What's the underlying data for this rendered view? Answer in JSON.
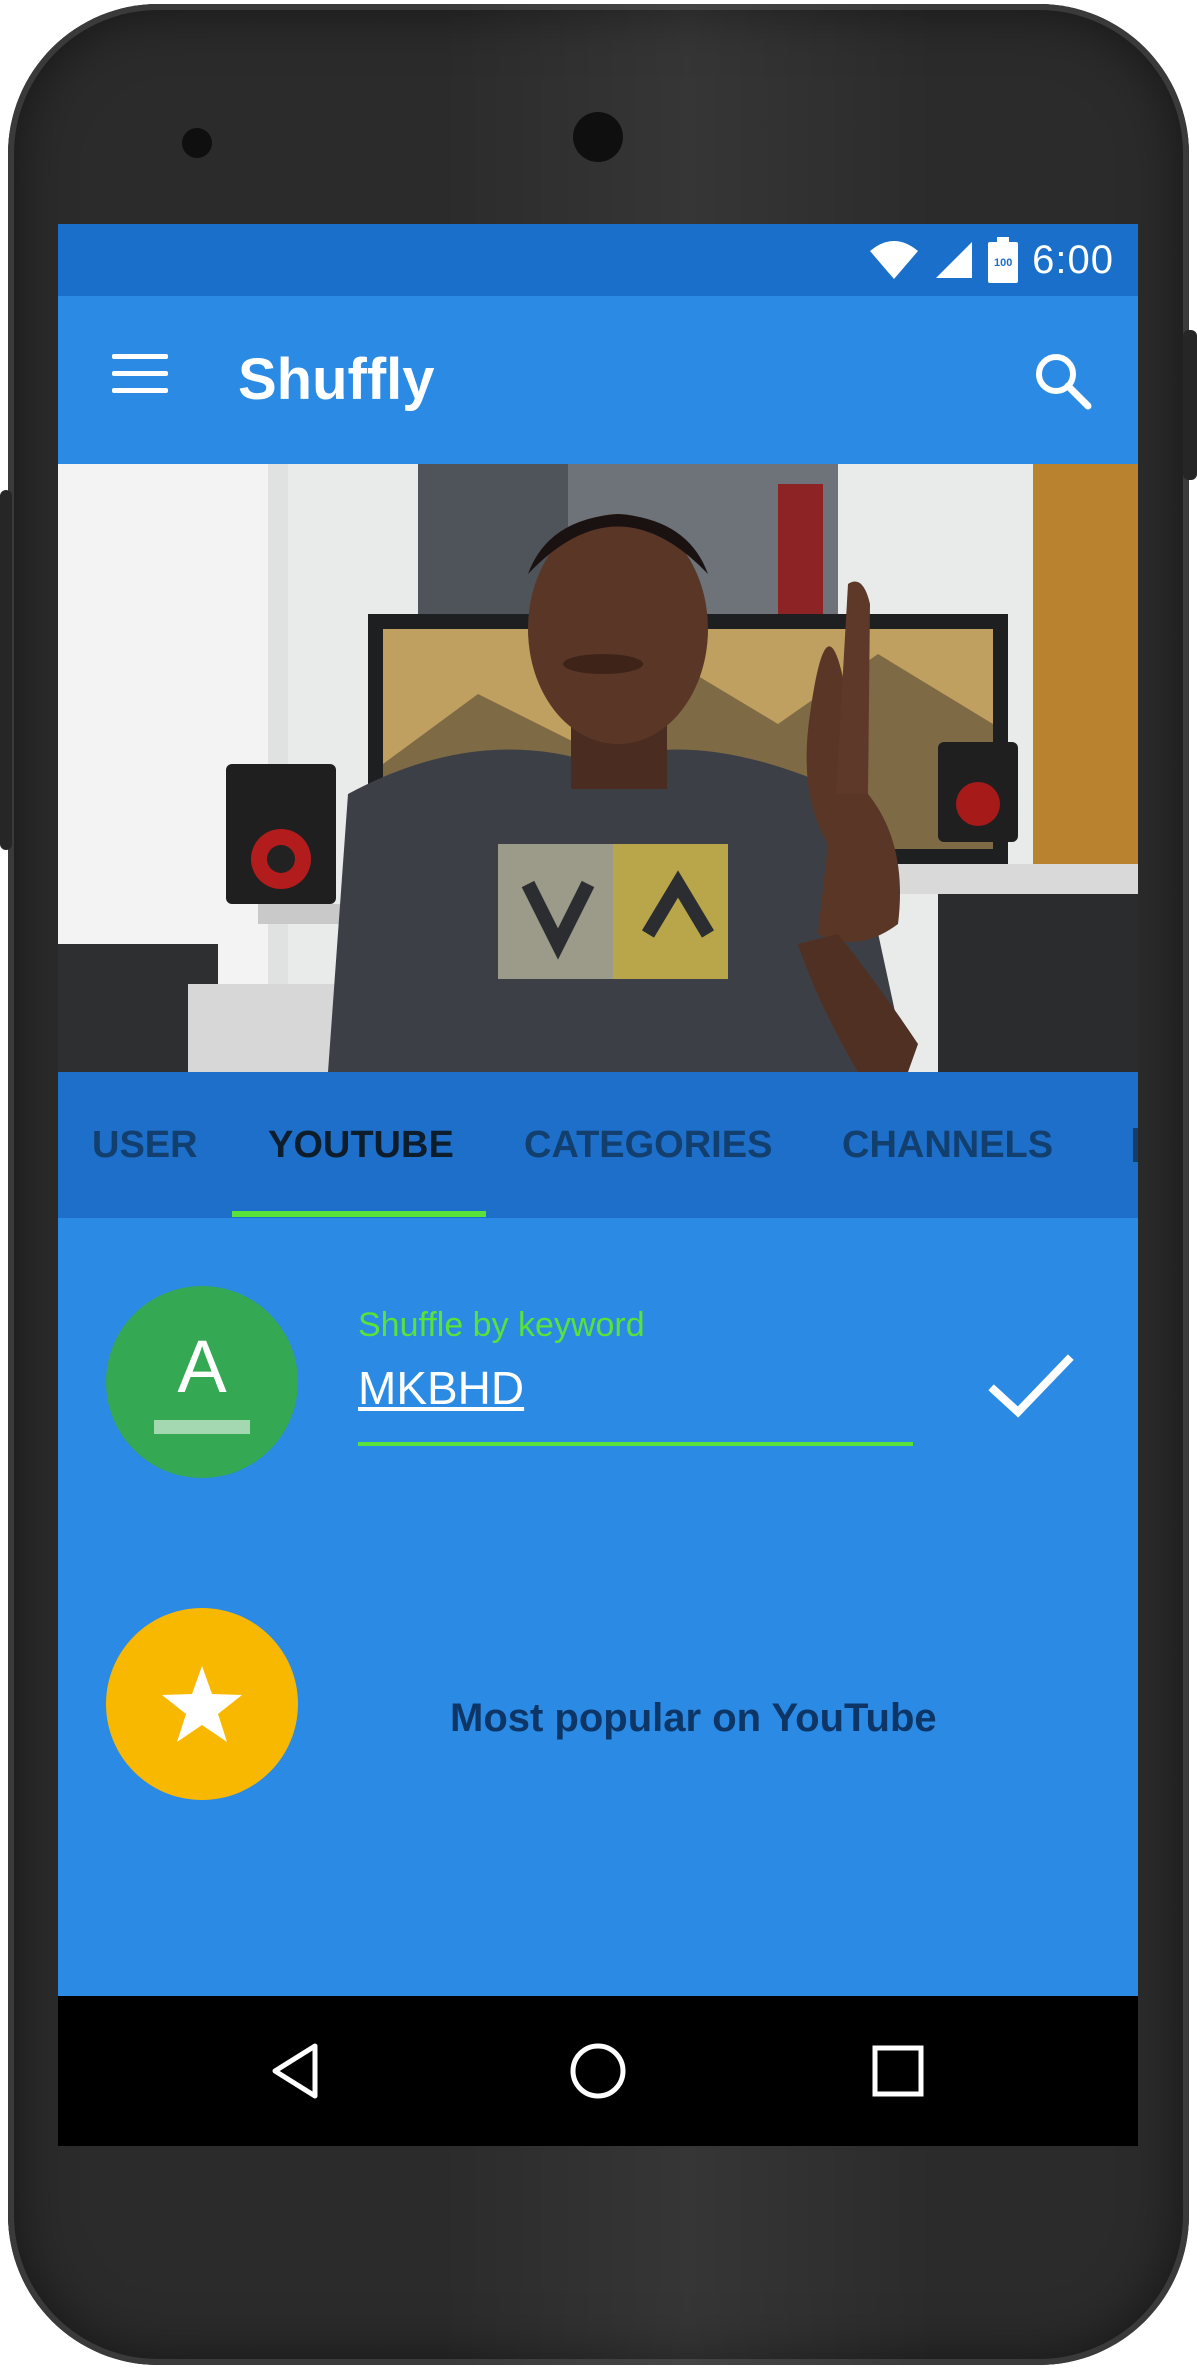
{
  "status_bar": {
    "time": "6:00",
    "battery_level": "100"
  },
  "app_bar": {
    "title": "Shuffly",
    "menu_icon": "hamburger-menu-icon",
    "search_icon": "search-icon"
  },
  "tabs": [
    {
      "label": "USER",
      "active": false
    },
    {
      "label": "YOUTUBE",
      "active": true
    },
    {
      "label": "CATEGORIES",
      "active": false
    },
    {
      "label": "CHANNELS",
      "active": false
    }
  ],
  "keyword_option": {
    "avatar_letter": "A",
    "hint": "Shuffle by keyword",
    "value": "MKBHD",
    "confirm_icon": "check-icon"
  },
  "popular_option": {
    "icon": "star-icon",
    "label": "Most popular on YouTube"
  },
  "colors": {
    "primary": "#2a8ae4",
    "primary_dark": "#1a6fcb",
    "accent": "#58e23a",
    "avatar_green": "#34a853",
    "avatar_yellow": "#f9b800"
  },
  "navigation_bar": {
    "back_icon": "back-triangle-icon",
    "home_icon": "home-circle-icon",
    "recents_icon": "recents-square-icon"
  }
}
